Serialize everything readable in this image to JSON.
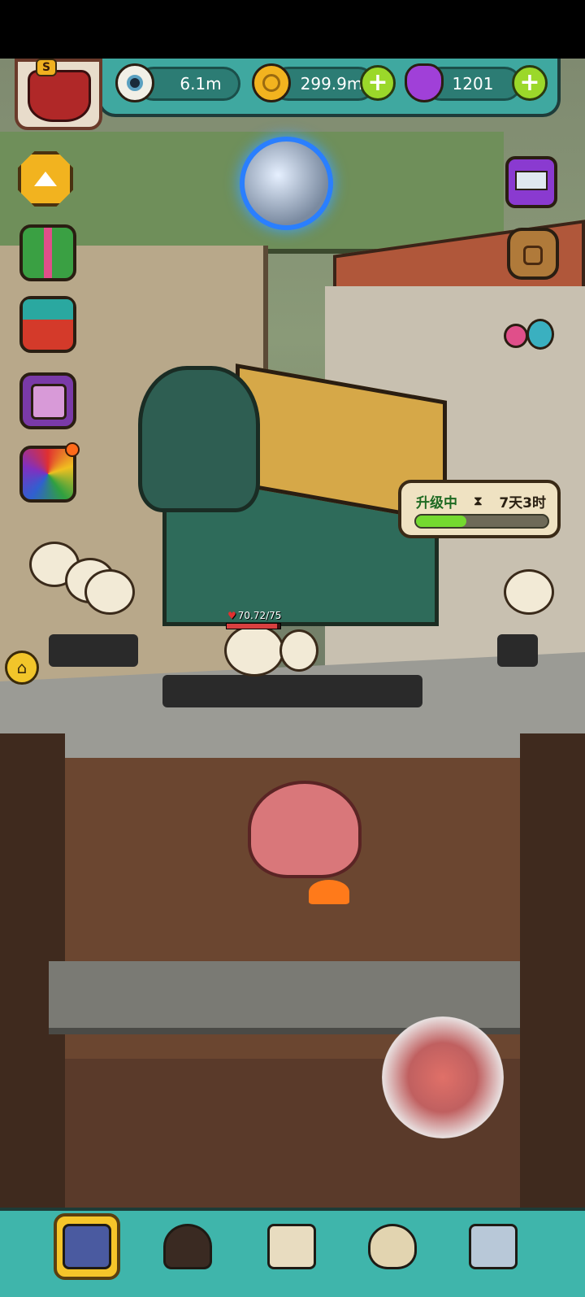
{
  "hud": {
    "eyeballs": "6.1m",
    "coins": "299.9m",
    "potions": "1201",
    "add_coins_label": "+",
    "add_potions_label": "+"
  },
  "rank_badge": {
    "letter": "S"
  },
  "upgrade": {
    "status": "升级中",
    "time_remaining": "7天3时",
    "progress": 0.38
  },
  "restaurant": {
    "hp_text": "70.72/75",
    "hp_fraction": 0.943
  },
  "side_buttons": [
    "arrow-up-icon",
    "gift-box-icon",
    "present-icon",
    "cards-icon",
    "rainbow-gift-icon"
  ],
  "right_buttons": [
    "tv-ad-icon",
    "backpack-icon",
    "monster-eggs-icon"
  ],
  "bottom_nav": [
    "building-icon",
    "monster-chef-icon",
    "recipe-book-icon",
    "coin-bag-icon",
    "grid-menu-icon"
  ],
  "colors": {
    "accent": "#3fa8a0",
    "coin": "#f2b31f",
    "plus": "#9bd82a",
    "progress": "#74d930"
  }
}
